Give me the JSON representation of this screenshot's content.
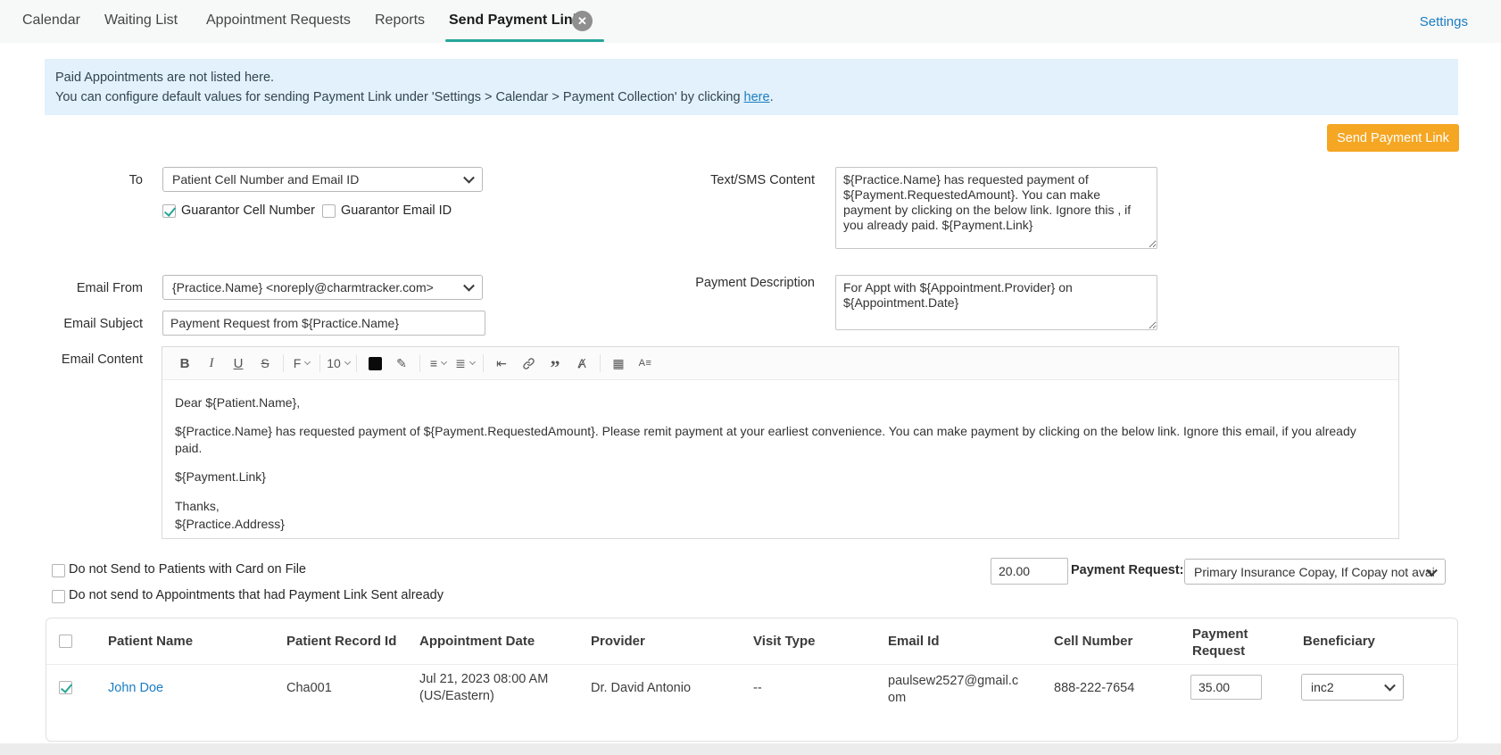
{
  "colors": {
    "accent": "#26a69a",
    "link": "#1b7dc2",
    "orange": "#f5a623",
    "banner-bg": "#e2f1fb",
    "banner-text": "#33454f"
  },
  "tabs": {
    "calendar": "Calendar",
    "waiting_list": "Waiting List",
    "appointment_requests": "Appointment Requests",
    "reports": "Reports",
    "send_payment_link": "Send Payment Link",
    "close_glyph": "✕",
    "settings": "Settings"
  },
  "banner": {
    "line1": "Paid Appointments are not listed here.",
    "line2_text": "You can configure default values for sending Payment Link under 'Settings > Calendar > Payment Collection' by clicking ",
    "line2_link": "here",
    "line2_end": "."
  },
  "actions": {
    "send_payment_link": "Send Payment Link"
  },
  "form": {
    "to": {
      "label": "To",
      "value": "Patient Cell Number and Email ID"
    },
    "guarantor_cell": {
      "label": "Guarantor Cell Number",
      "checked": true
    },
    "guarantor_email": {
      "label": "Guarantor Email ID",
      "checked": false
    },
    "sms": {
      "label": "Text/SMS Content",
      "value": "${Practice.Name} has requested payment of ${Payment.RequestedAmount}. You can make payment by clicking on the below link. Ignore this , if you already paid. ${Payment.Link}"
    },
    "email_from": {
      "label": "Email From",
      "value": "{Practice.Name} <noreply@charmtracker.com>"
    },
    "payment_description": {
      "label": "Payment Description",
      "value": "For Appt with ${Appointment.Provider} on ${Appointment.Date}"
    },
    "email_subject": {
      "label": "Email Subject",
      "value": "Payment Request from ${Practice.Name}"
    },
    "email_content": {
      "label": "Email Content"
    }
  },
  "editor": {
    "toolbar": [
      {
        "name": "bold-icon",
        "glyph": "B"
      },
      {
        "name": "italic-icon",
        "glyph": "I"
      },
      {
        "name": "underline-icon",
        "glyph": "U"
      },
      {
        "name": "strikethrough-icon",
        "glyph": "S"
      },
      {
        "name": "font-family-icon",
        "glyph": "F"
      },
      {
        "name": "font-size-value",
        "glyph": "10"
      },
      {
        "name": "highlight-icon",
        "glyph": "✎"
      },
      {
        "name": "align-icon",
        "glyph": "≡"
      },
      {
        "name": "list-icon",
        "glyph": "≣"
      },
      {
        "name": "indent-icon",
        "glyph": "⇤"
      },
      {
        "name": "quote-icon",
        "glyph": "”"
      },
      {
        "name": "clear-format-icon",
        "glyph": "Ⱥ"
      },
      {
        "name": "table-icon",
        "glyph": "▦"
      },
      {
        "name": "line-height-icon",
        "glyph": "A≡"
      }
    ],
    "body": {
      "greeting": "Dear ${Patient.Name},",
      "paragraph": "${Practice.Name} has requested payment of ${Payment.RequestedAmount}. Please remit payment at your earliest convenience. You can make payment by clicking on the below link. Ignore this email, if you already paid.",
      "link_line": "${Payment.Link}",
      "closing": "Thanks,",
      "address": "${Practice.Address}"
    }
  },
  "options": {
    "no_card_on_file": "Do not Send to Patients with Card on File",
    "no_already_sent": "Do not send to Appointments that had Payment Link Sent already",
    "amount": "20.00",
    "payment_request_label": "Payment Request:",
    "payment_request_value": "Primary Insurance Copay, If Copay not avai"
  },
  "table": {
    "headers": {
      "patient_name": "Patient Name",
      "patient_record_id": "Patient Record Id",
      "appointment_date": "Appointment Date",
      "provider": "Provider",
      "visit_type": "Visit Type",
      "email_id": "Email Id",
      "cell_number": "Cell Number",
      "payment_request": "Payment Request",
      "beneficiary": "Beneficiary"
    },
    "row": {
      "patient_name": "John Doe",
      "patient_record_id": "Cha001",
      "appointment_date": "Jul 21, 2023 08:00 AM (US/Eastern)",
      "provider": "Dr. David Antonio",
      "visit_type": "--",
      "email_id": "paulsew2527@gmail.com",
      "cell_number": "888-222-7654",
      "payment_request": "35.00",
      "beneficiary": "inc2"
    }
  }
}
